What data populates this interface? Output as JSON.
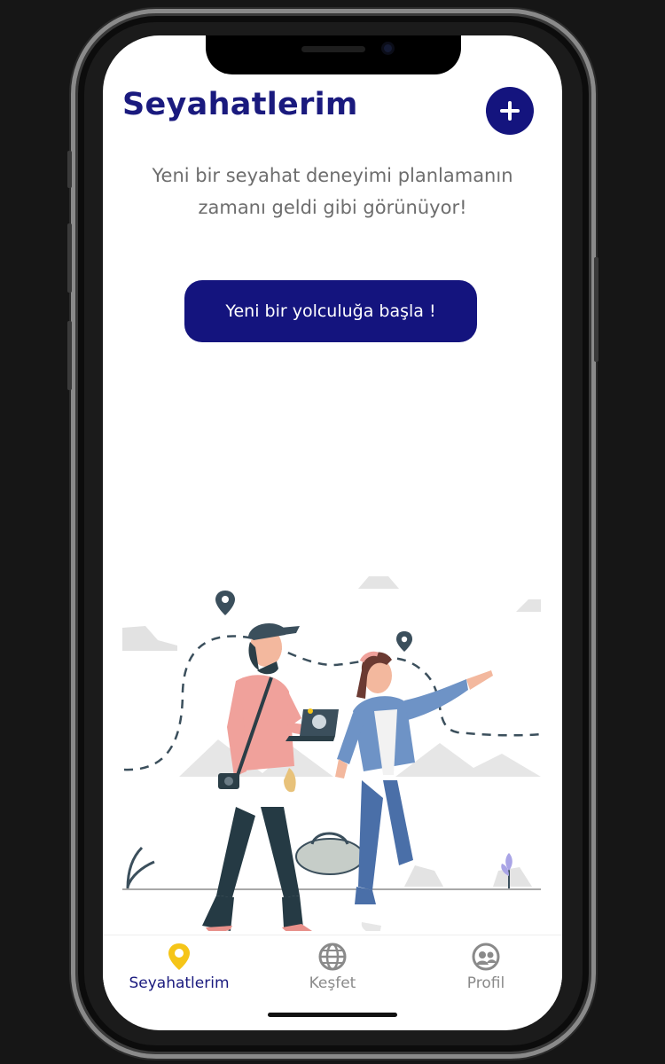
{
  "header": {
    "title": "Seyahatlerim",
    "add_button_icon": "plus-icon"
  },
  "empty_state": {
    "message_line1": "Yeni bir seyahat deneyimi planlamanın",
    "message_line2": "zamanı geldi gibi görünüyor!",
    "cta_label": "Yeni bir yolculuğa başla !"
  },
  "tabs": [
    {
      "label": "Seyahatlerim",
      "icon": "map-pin-icon",
      "active": true
    },
    {
      "label": "Keşfet",
      "icon": "globe-icon",
      "active": false
    },
    {
      "label": "Profil",
      "icon": "profile-icon",
      "active": false
    }
  ],
  "colors": {
    "primary": "#14147e",
    "accent_active_icon": "#f5c518",
    "inactive_icon": "#8a8a8a",
    "text_muted": "#6d6d6d"
  }
}
